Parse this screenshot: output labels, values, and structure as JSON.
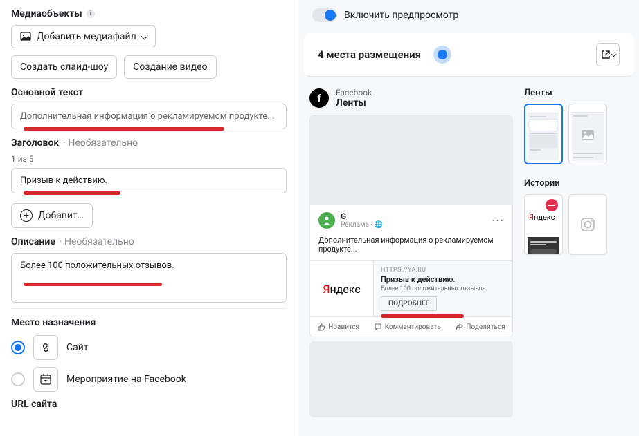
{
  "left": {
    "media_objects_label": "Медиаобъекты",
    "add_media_btn": "Добавить медиафайл",
    "create_slideshow_btn": "Создать слайд-шоу",
    "create_video_btn": "Создание видео",
    "main_text_label": "Основной текст",
    "main_text_value": "Дополнительная информация о рекламируемом продукте...",
    "headline_label": "Заголовок",
    "optional_label": "Необязательно",
    "headline_counter": "1 из 5",
    "headline_value": "Призыв к действию.",
    "add_btn": "Добавит…",
    "description_label": "Описание",
    "description_value": "Более 100 положительных отзывов.",
    "destination_label": "Место назначения",
    "dest_website": "Сайт",
    "dest_fb_event": "Мероприятие на Facebook",
    "url_label": "URL сайта"
  },
  "right": {
    "toggle_preview": "Включить предпросмотр",
    "placements_count": "4 места размещения",
    "preview_platform_small": "Facebook",
    "preview_platform_main": "Ленты",
    "ad": {
      "profile_name": "G",
      "sponsored": "Реклама ·",
      "body": "Дополнительная информация о рекламируемом продукте...",
      "brand_ya": "Я",
      "brand_ndex": "ндекс",
      "domain": "HTTPS://YA.RU",
      "title": "Призыв к действию.",
      "desc": "Более 100 положительных отзывов.",
      "cta": "ПОДРОБНЕЕ",
      "like": "Нравится",
      "comment": "Комментировать",
      "share": "Поделиться"
    },
    "side": {
      "feeds_label": "Ленты",
      "stories_label": "Истории",
      "yandex_ya": "Я",
      "yandex_ndex": "ндекс"
    }
  }
}
